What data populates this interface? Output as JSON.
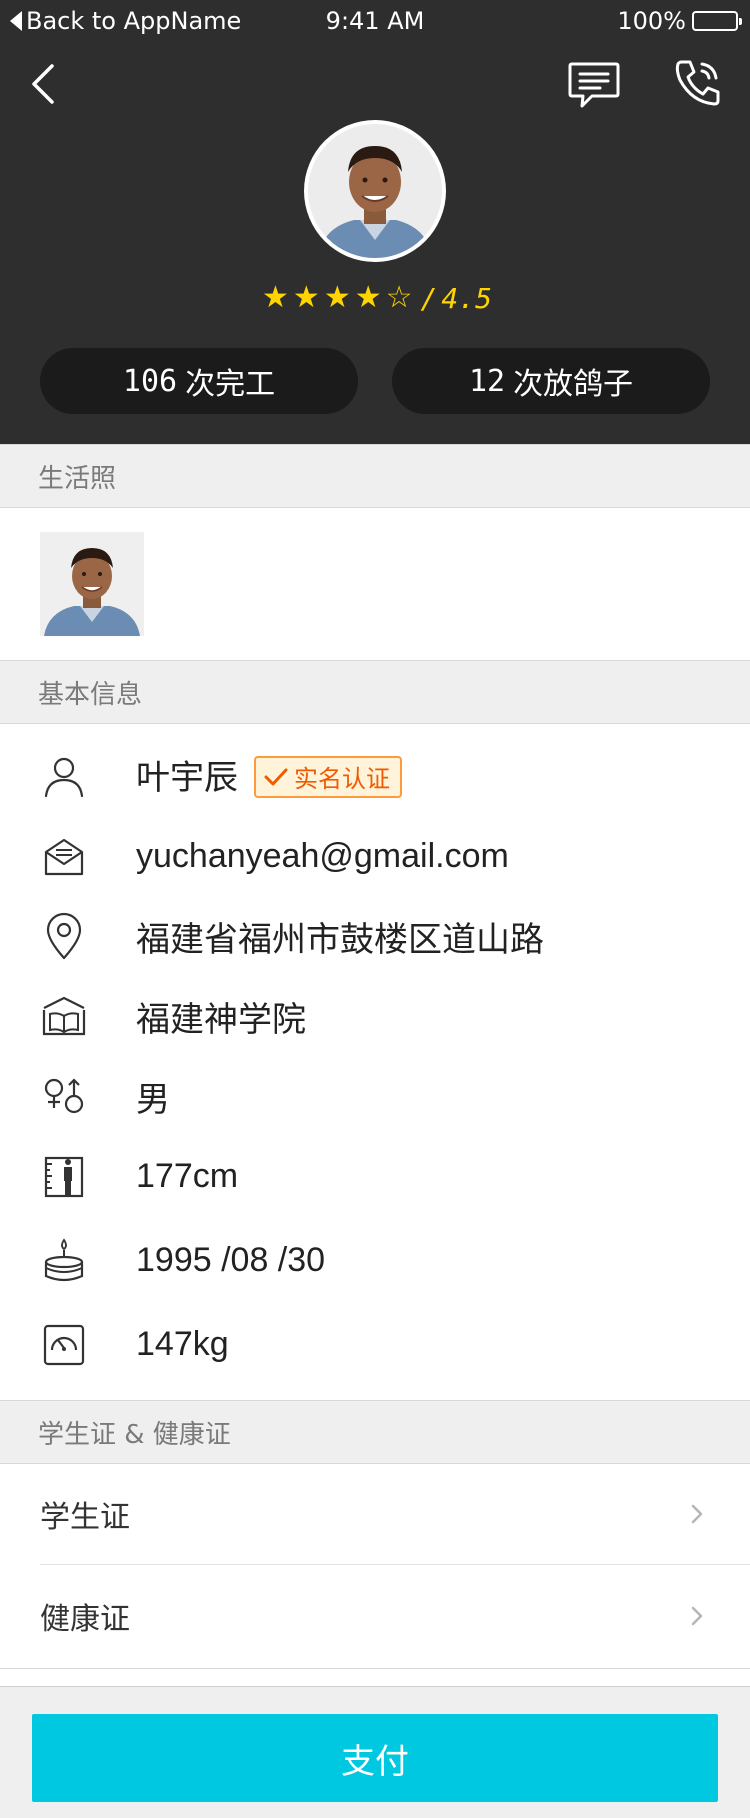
{
  "status_bar": {
    "back_app": "Back to AppName",
    "time": "9:41 AM",
    "battery": "100%"
  },
  "icons": {
    "back": "chevron-left-icon",
    "message": "chat-bubble-icon",
    "call": "phone-icon"
  },
  "profile": {
    "rating_slash": "/",
    "rating_value": "4.5",
    "stars_filled": 4,
    "stars_total": 5,
    "completed_count": "106",
    "completed_label": "次完工",
    "noshow_count": "12",
    "noshow_label": "次放鸽子"
  },
  "sections": {
    "life_photos": "生活照",
    "basic_info": "基本信息",
    "certificates": "学生证 & 健康证"
  },
  "basic_info": {
    "name": "叶宇辰",
    "verified_label": "实名认证",
    "email": "yuchanyeah@gmail.com",
    "address": "福建省福州市鼓楼区道山路",
    "school": "福建神学院",
    "gender": "男",
    "height": "177cm",
    "birthday": "1995 /08 /30",
    "weight": "147kg"
  },
  "certificates": {
    "student_card": "学生证",
    "health_card": "健康证"
  },
  "footer": {
    "pay_label": "支付"
  },
  "colors": {
    "header_bg": "#2e2e2e",
    "star": "#ffd400",
    "verify_text": "#f05a00",
    "pay_button": "#00c8e0"
  }
}
